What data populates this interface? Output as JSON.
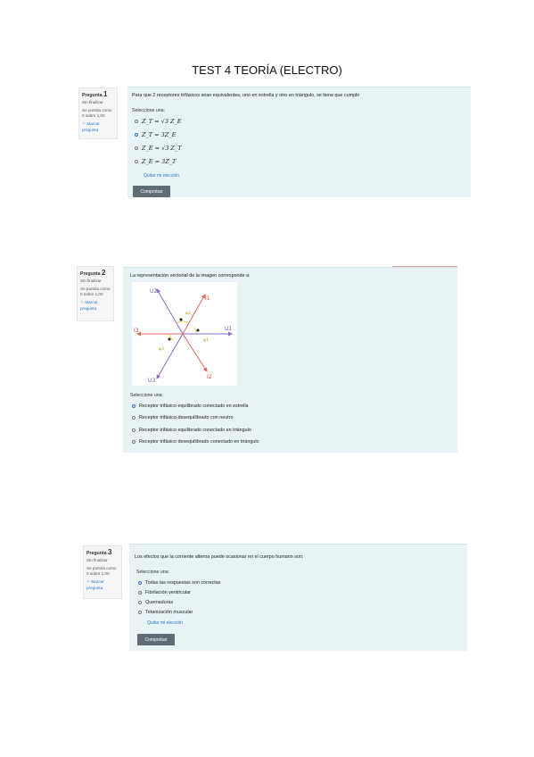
{
  "document": {
    "title": "TEST 4 TEORÍA (ELECTRO)"
  },
  "questions": [
    {
      "info": {
        "label": "Pregunta",
        "number": "1",
        "status": "Sin finalizar",
        "score": "Se puntúa como 0 sobre 1,00",
        "flag": "Marcar pregunta"
      },
      "text": "Para que 2 receptores trifásicos sean equivalentes, uno en estrella y otro en triángulo, se tiene que cumplir",
      "prompt": "Seleccione una:",
      "options": [
        {
          "label": "Z_T = √3 Z_E",
          "selected": false
        },
        {
          "label": "Z_T = 3Z_E",
          "selected": true
        },
        {
          "label": "Z_E = √3 Z_T",
          "selected": false
        },
        {
          "label": "Z_E = 3Z_T",
          "selected": false
        }
      ],
      "clear_link": "Quitar mi elección",
      "check_button": "Comprobar"
    },
    {
      "info": {
        "label": "Pregunta",
        "number": "2",
        "status": "Sin finalizar",
        "score": "Se puntúa como 0 sobre 1,00",
        "flag": "Marcar pregunta"
      },
      "text": "La representación vectorial de la imagen corresponde a:",
      "diagram_labels": {
        "u1": "U1",
        "u2": "U2",
        "u3": "U3",
        "i1": "I1",
        "i2": "I2",
        "i3": "I3",
        "phi1": "φ1",
        "phi2": "φ2",
        "phi3": "φ3"
      },
      "prompt": "Seleccione una:",
      "options": [
        {
          "label": "Receptor trifásico equilibrado conectado en estrella",
          "selected": true
        },
        {
          "label": "Receptor trifásico desequilibrado con neutro",
          "selected": false
        },
        {
          "label": "Receptor trifásico equilibrado conectado en triángulo",
          "selected": false
        },
        {
          "label": "Receptor trifásico desequilibrado conectado en triángulo",
          "selected": false
        }
      ]
    },
    {
      "info": {
        "label": "Pregunta",
        "number": "3",
        "status": "Sin finalizar",
        "score": "Se puntúa como 0 sobre 1,00",
        "flag": "Marcar pregunta"
      },
      "text": "Los efectos que la corriente alterna puede ocasionar en el cuerpo humano son:",
      "prompt": "Seleccione una:",
      "options": [
        {
          "label": "Todas las respuestas son correctas",
          "selected": true
        },
        {
          "label": "Fibrilación ventricular",
          "selected": false
        },
        {
          "label": "Quemaduras",
          "selected": false
        },
        {
          "label": "Tetanización muscular",
          "selected": false
        }
      ],
      "clear_link": "Quitar mi elección",
      "check_button": "Comprobar"
    }
  ],
  "colors": {
    "panel_bg": "#e7f3f5",
    "info_bg": "#f4f5f6",
    "link": "#2a77c9",
    "button": "#5f6b75",
    "selected_radio": "#3a6fc4",
    "diagram_u": "#8a6bd1",
    "diagram_i": "#e06a5e",
    "diagram_phi": "#e8c032"
  }
}
